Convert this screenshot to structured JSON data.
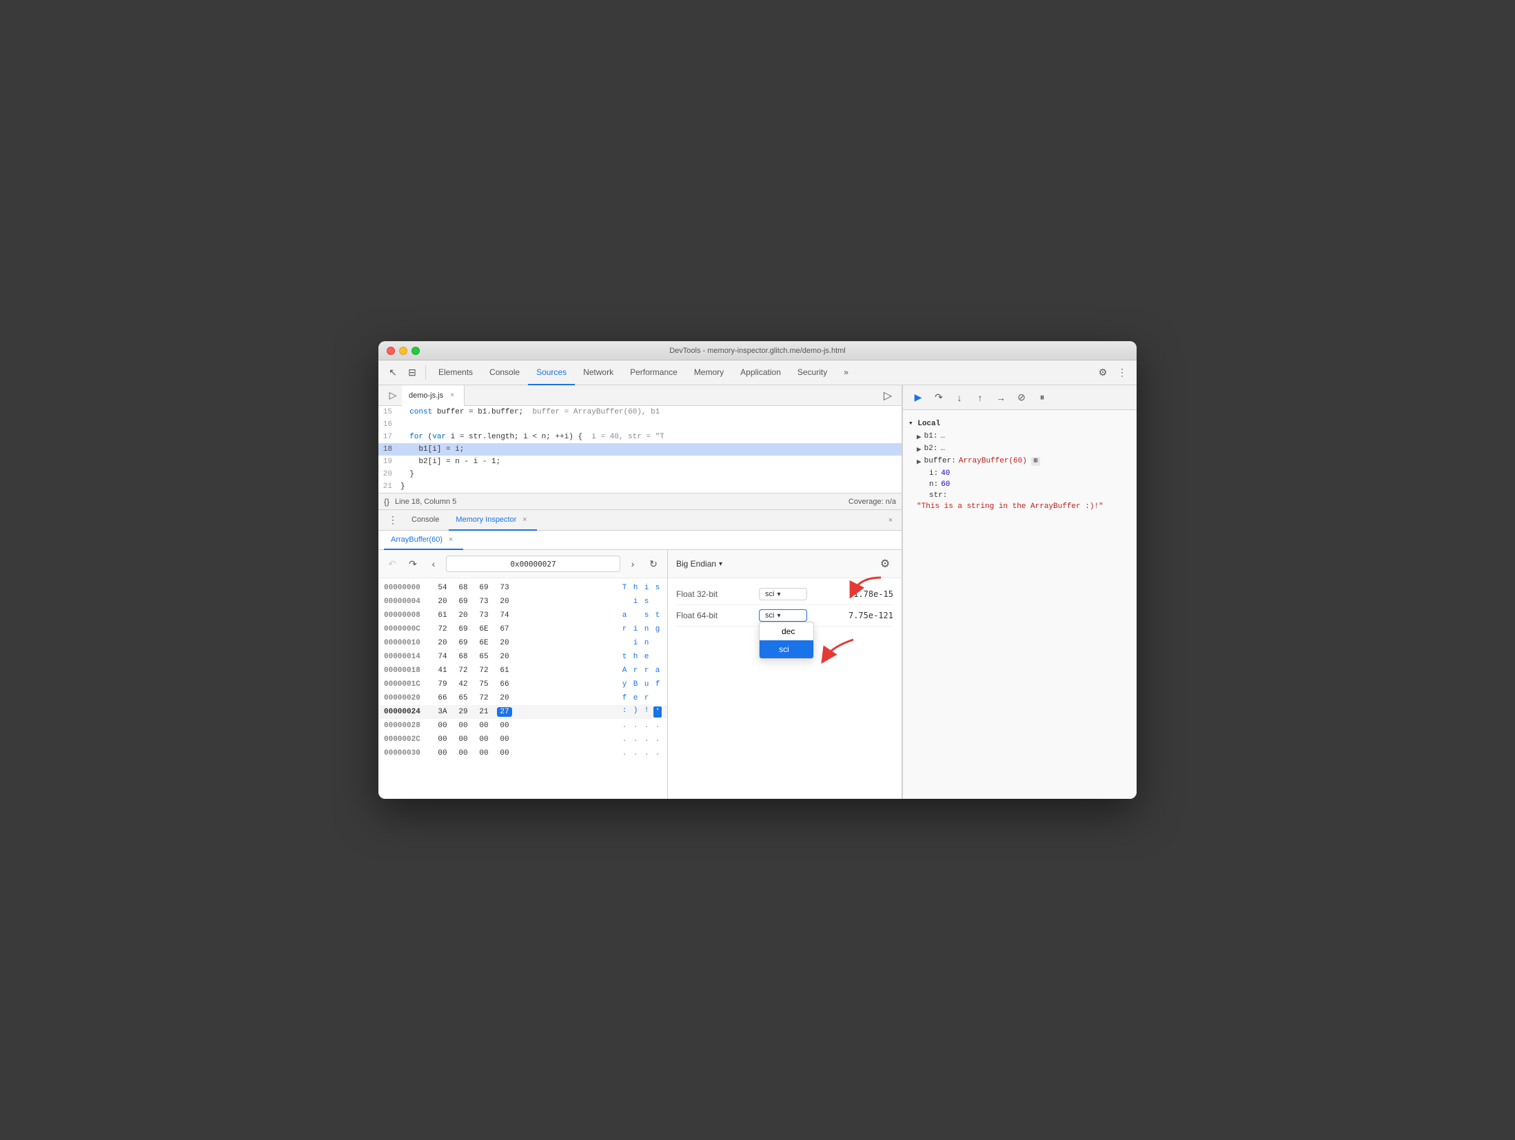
{
  "window": {
    "title": "DevTools - memory-inspector.glitch.me/demo-js.html"
  },
  "tabs": {
    "elements": "Elements",
    "console": "Console",
    "sources": "Sources",
    "network": "Network",
    "performance": "Performance",
    "memory": "Memory",
    "application": "Application",
    "security": "Security",
    "more": "»"
  },
  "editor": {
    "filename": "demo-js.js",
    "lines": [
      {
        "num": "15",
        "text": "  const buffer = b1.buffer;  buffer = ArrayBuffer(60), b1",
        "highlighted": false
      },
      {
        "num": "16",
        "text": "",
        "highlighted": false
      },
      {
        "num": "17",
        "text": "  for (var i = str.length; i < n; ++i) {  i = 40, str = \"T",
        "highlighted": false
      },
      {
        "num": "18",
        "text": "    b1[i] = i;",
        "highlighted": true
      },
      {
        "num": "19",
        "text": "    b2[i] = n - i - 1;",
        "highlighted": false
      },
      {
        "num": "20",
        "text": "  }",
        "highlighted": false
      },
      {
        "num": "21",
        "text": "}",
        "highlighted": false
      }
    ],
    "status_line": "Line 18, Column 5",
    "coverage": "Coverage: n/a"
  },
  "bottom_panel": {
    "tabs": [
      "Console",
      "Memory Inspector"
    ],
    "active_tab": "Memory Inspector",
    "close_button": "×"
  },
  "memory_inspector": {
    "buffer_tab": "ArrayBuffer(60)",
    "address": "0x00000027",
    "rows": [
      {
        "addr": "00000000",
        "bytes": [
          "54",
          "68",
          "69",
          "73"
        ],
        "chars": [
          "T",
          "h",
          "i",
          "s"
        ],
        "char_types": [
          "blue",
          "blue",
          "blue",
          "blue"
        ]
      },
      {
        "addr": "00000004",
        "bytes": [
          "20",
          "69",
          "73",
          "20"
        ],
        "chars": [
          " ",
          "i",
          "s",
          " "
        ],
        "char_types": [
          "dot",
          "blue",
          "blue",
          "dot"
        ]
      },
      {
        "addr": "00000008",
        "bytes": [
          "61",
          "20",
          "73",
          "74"
        ],
        "chars": [
          "a",
          " ",
          "s",
          "t"
        ],
        "char_types": [
          "blue",
          "dot",
          "blue",
          "blue"
        ]
      },
      {
        "addr": "0000000C",
        "bytes": [
          "72",
          "69",
          "6E",
          "67"
        ],
        "chars": [
          "r",
          "i",
          "n",
          "g"
        ],
        "char_types": [
          "blue",
          "blue",
          "blue",
          "blue"
        ]
      },
      {
        "addr": "00000010",
        "bytes": [
          "20",
          "69",
          "6E",
          "20"
        ],
        "chars": [
          " ",
          "i",
          "n",
          " "
        ],
        "char_types": [
          "dot",
          "blue",
          "blue",
          "dot"
        ]
      },
      {
        "addr": "00000014",
        "bytes": [
          "74",
          "68",
          "65",
          "20"
        ],
        "chars": [
          "t",
          "h",
          "e",
          " "
        ],
        "char_types": [
          "blue",
          "blue",
          "blue",
          "dot"
        ]
      },
      {
        "addr": "00000018",
        "bytes": [
          "41",
          "72",
          "72",
          "61"
        ],
        "chars": [
          "A",
          "r",
          "r",
          "a"
        ],
        "char_types": [
          "blue",
          "blue",
          "blue",
          "blue"
        ]
      },
      {
        "addr": "0000001C",
        "bytes": [
          "79",
          "42",
          "75",
          "66"
        ],
        "chars": [
          "y",
          "B",
          "u",
          "f"
        ],
        "char_types": [
          "blue",
          "blue",
          "blue",
          "blue"
        ]
      },
      {
        "addr": "00000020",
        "bytes": [
          "66",
          "65",
          "72",
          "20"
        ],
        "chars": [
          "f",
          "e",
          "r",
          " "
        ],
        "char_types": [
          "blue",
          "blue",
          "blue",
          "dot"
        ]
      },
      {
        "addr": "00000024",
        "bytes": [
          "3A",
          "29",
          "21",
          "27"
        ],
        "chars": [
          ":",
          ")",
          "!",
          "'"
        ],
        "char_types": [
          "blue",
          "blue",
          "blue",
          "selected"
        ],
        "highlighted": true,
        "selected_byte_idx": 3
      },
      {
        "addr": "00000028",
        "bytes": [
          "00",
          "00",
          "00",
          "00"
        ],
        "chars": [
          ".",
          ".",
          ".",
          "."
        ],
        "char_types": [
          "dot",
          "dot",
          "dot",
          "dot"
        ]
      },
      {
        "addr": "0000002C",
        "bytes": [
          "00",
          "00",
          "00",
          "00"
        ],
        "chars": [
          ".",
          ".",
          ".",
          "."
        ],
        "char_types": [
          "dot",
          "dot",
          "dot",
          "dot"
        ]
      },
      {
        "addr": "00000030",
        "bytes": [
          "00",
          "00",
          "00",
          "00"
        ],
        "chars": [
          ".",
          ".",
          ".",
          "."
        ],
        "char_types": [
          "dot",
          "dot",
          "dot",
          "dot"
        ]
      }
    ]
  },
  "inspector": {
    "endian": "Big Endian",
    "rows": [
      {
        "label": "Float 32-bit",
        "format": "sci",
        "value": "1.78e-15",
        "dropdown_open": false
      },
      {
        "label": "Float 64-bit",
        "format": "sci",
        "value": "7.75e-121",
        "dropdown_open": true
      }
    ],
    "dropdown_options": [
      "dec",
      "sci"
    ],
    "selected_option": "sci"
  },
  "debugger": {
    "scope_header": "Local",
    "variables": [
      {
        "name": "b1:",
        "value": "…",
        "expandable": true
      },
      {
        "name": "b2:",
        "value": "…",
        "expandable": true
      },
      {
        "name": "buffer:",
        "value": "ArrayBuffer(60)",
        "expandable": true,
        "has_icon": true
      },
      {
        "name": "i:",
        "value": "40",
        "type": "num"
      },
      {
        "name": "n:",
        "value": "60",
        "type": "num"
      },
      {
        "name": "str:",
        "value": "\"This is a string in the ArrayBuffer :)!\"",
        "type": "str"
      }
    ]
  },
  "icons": {
    "cursor": "↖",
    "layers": "⊞",
    "gear": "⚙",
    "more_vert": "⋮",
    "play": "▶",
    "pause": "⏸",
    "step_over": "↷",
    "step_into": "↓",
    "step_out": "↑",
    "step_back": "↩",
    "deactivate": "⊘",
    "back": "↶",
    "forward": "↷",
    "prev": "‹",
    "next": "›",
    "refresh": "↻",
    "settings": "⚙",
    "close": "×",
    "chevron_down": "▾",
    "expand": "▶",
    "check": "✓"
  }
}
